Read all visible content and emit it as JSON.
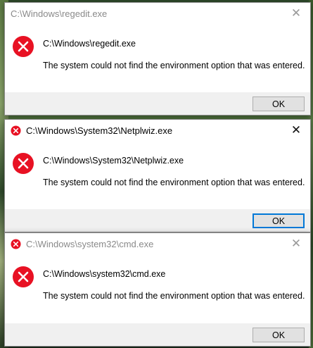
{
  "colors": {
    "error_red": "#e81123",
    "accent": "#0078d7",
    "footer_bg": "#f0f0f0",
    "inactive_title": "#8a8a8a"
  },
  "dialogs": [
    {
      "title": "C:\\Windows\\regedit.exe",
      "active": false,
      "title_icon": null,
      "path": "C:\\Windows\\regedit.exe",
      "message": "The system could not find the environment option that was entered.",
      "ok_label": "OK",
      "close_glyph": "✕"
    },
    {
      "title": "C:\\Windows\\System32\\Netplwiz.exe",
      "active": true,
      "title_icon": "error-icon",
      "path": "C:\\Windows\\System32\\Netplwiz.exe",
      "message": "The system could not find the environment option that was entered.",
      "ok_label": "OK",
      "close_glyph": "✕"
    },
    {
      "title": "C:\\Windows\\system32\\cmd.exe",
      "active": false,
      "title_icon": "error-icon",
      "path": "C:\\Windows\\system32\\cmd.exe",
      "message": "The system could not find the environment option that was entered.",
      "ok_label": "OK",
      "close_glyph": "✕"
    }
  ]
}
